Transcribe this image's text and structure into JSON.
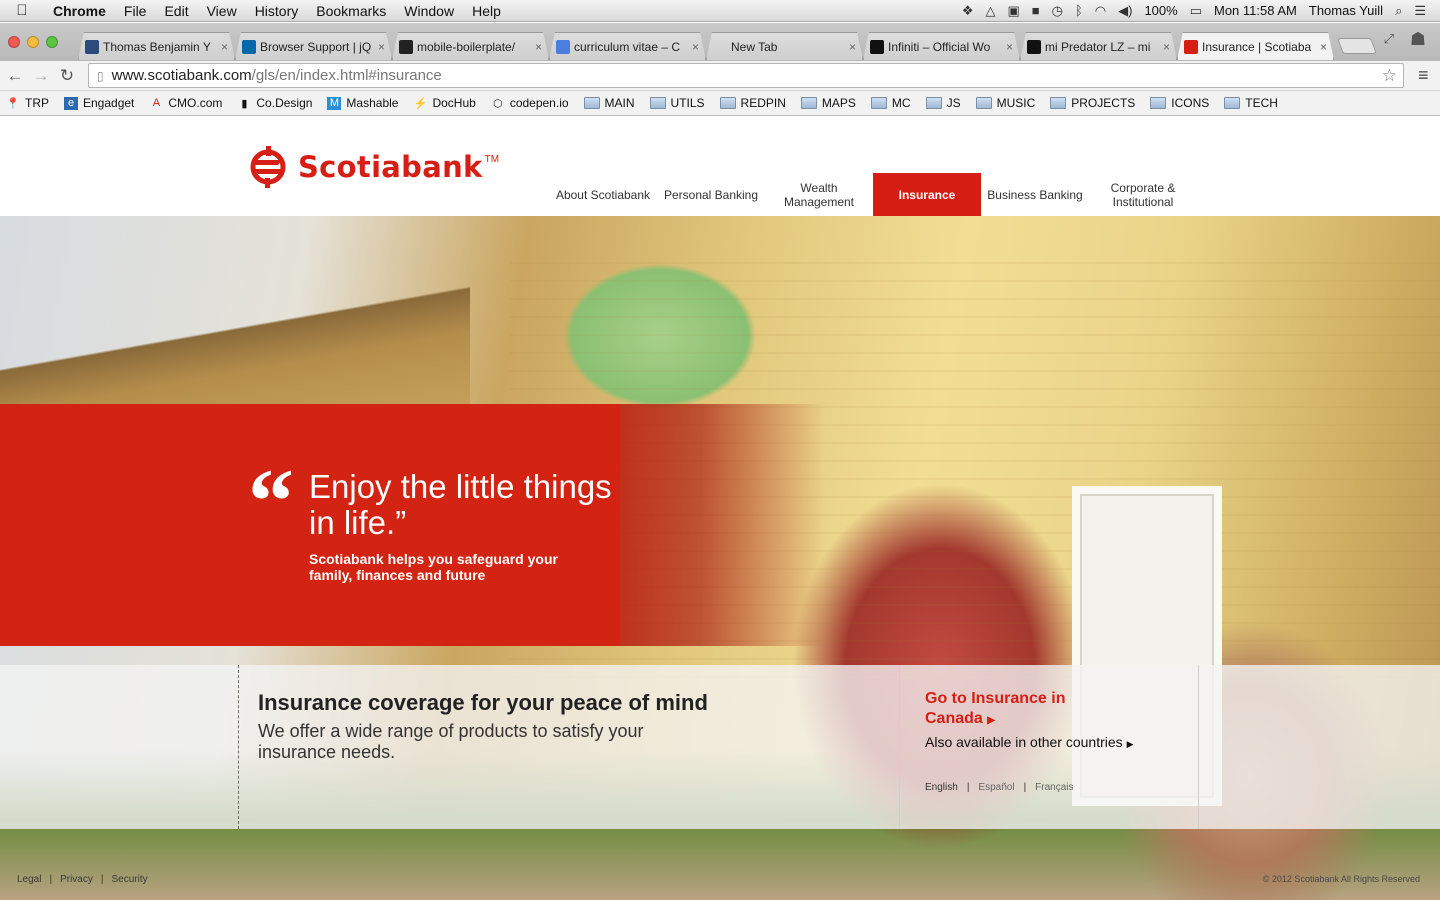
{
  "menubar": {
    "app": "Chrome",
    "items": [
      "File",
      "Edit",
      "View",
      "History",
      "Bookmarks",
      "Window",
      "Help"
    ],
    "battery": "100%",
    "clock": "Mon 11:58 AM",
    "user": "Thomas Yuill"
  },
  "tabs": [
    {
      "title": "Thomas Benjamin Y",
      "icon": "globe-icon",
      "color": "#2a4b7c"
    },
    {
      "title": "Browser Support | jQ",
      "icon": "jquery-icon",
      "color": "#0868ac"
    },
    {
      "title": "mobile-boilerplate/",
      "icon": "github-icon",
      "color": "#222222"
    },
    {
      "title": "curriculum vitae – C",
      "icon": "google-icon",
      "color": "#4a7fe0"
    },
    {
      "title": "New Tab",
      "icon": "",
      "color": ""
    },
    {
      "title": "Infiniti – Official Wo",
      "icon": "infiniti-icon",
      "color": "#111111"
    },
    {
      "title": "mi Predator LZ – mi",
      "icon": "adidas-icon",
      "color": "#111111"
    },
    {
      "title": "Insurance | Scotiaba",
      "icon": "scotiabank-icon",
      "color": "#d71e15"
    }
  ],
  "address": {
    "host": "www.scotiabank.com",
    "path": "/gls/en/index.html#insurance"
  },
  "bookmarks": [
    {
      "label": "TRP",
      "type": "link",
      "icon": "pin-icon"
    },
    {
      "label": "Engadget",
      "type": "link",
      "icon": "engadget-icon"
    },
    {
      "label": "CMO.com",
      "type": "link",
      "icon": "adobe-icon"
    },
    {
      "label": "Co.Design",
      "type": "link",
      "icon": "codesign-icon"
    },
    {
      "label": "Mashable",
      "type": "link",
      "icon": "mashable-icon"
    },
    {
      "label": "DocHub",
      "type": "link",
      "icon": "bolt-icon"
    },
    {
      "label": "codepen.io",
      "type": "link",
      "icon": "codepen-icon"
    },
    {
      "label": "MAIN",
      "type": "folder"
    },
    {
      "label": "UTILS",
      "type": "folder"
    },
    {
      "label": "REDPIN",
      "type": "folder"
    },
    {
      "label": "MAPS",
      "type": "folder"
    },
    {
      "label": "MC",
      "type": "folder"
    },
    {
      "label": "JS",
      "type": "folder"
    },
    {
      "label": "MUSIC",
      "type": "folder"
    },
    {
      "label": "PROJECTS",
      "type": "folder"
    },
    {
      "label": "ICONS",
      "type": "folder"
    },
    {
      "label": "TECH",
      "type": "folder"
    }
  ],
  "site": {
    "brand": "Scotiabank",
    "trademark": "TM",
    "brand_color": "#d71e15",
    "nav": [
      {
        "label": "About Scotiabank",
        "active": false
      },
      {
        "label": "Personal Banking",
        "active": false
      },
      {
        "label": "Wealth Management",
        "active": false
      },
      {
        "label": "Insurance",
        "active": true
      },
      {
        "label": "Business Banking",
        "active": false
      },
      {
        "label": "Corporate & Institutional",
        "active": false
      }
    ],
    "hero": {
      "quote_mark": "“",
      "headline": "Enjoy the little things in life.”",
      "subhead": "Scotiabank helps you safeguard your family, finances and future"
    },
    "coverage": {
      "title": "Insurance coverage for your peace of mind",
      "text": "We offer a wide range of products to satisfy your insurance needs."
    },
    "goto": {
      "label": "Go to Insurance in Canada",
      "arrow": "▶"
    },
    "other_countries": {
      "label": "Also available in other countries",
      "arrow": "▶"
    },
    "languages": [
      "English",
      "Español",
      "Français"
    ],
    "footer": {
      "links": [
        "Legal",
        "Privacy",
        "Security"
      ],
      "copyright": "© 2012 Scotiabank All Rights Reserved"
    }
  }
}
